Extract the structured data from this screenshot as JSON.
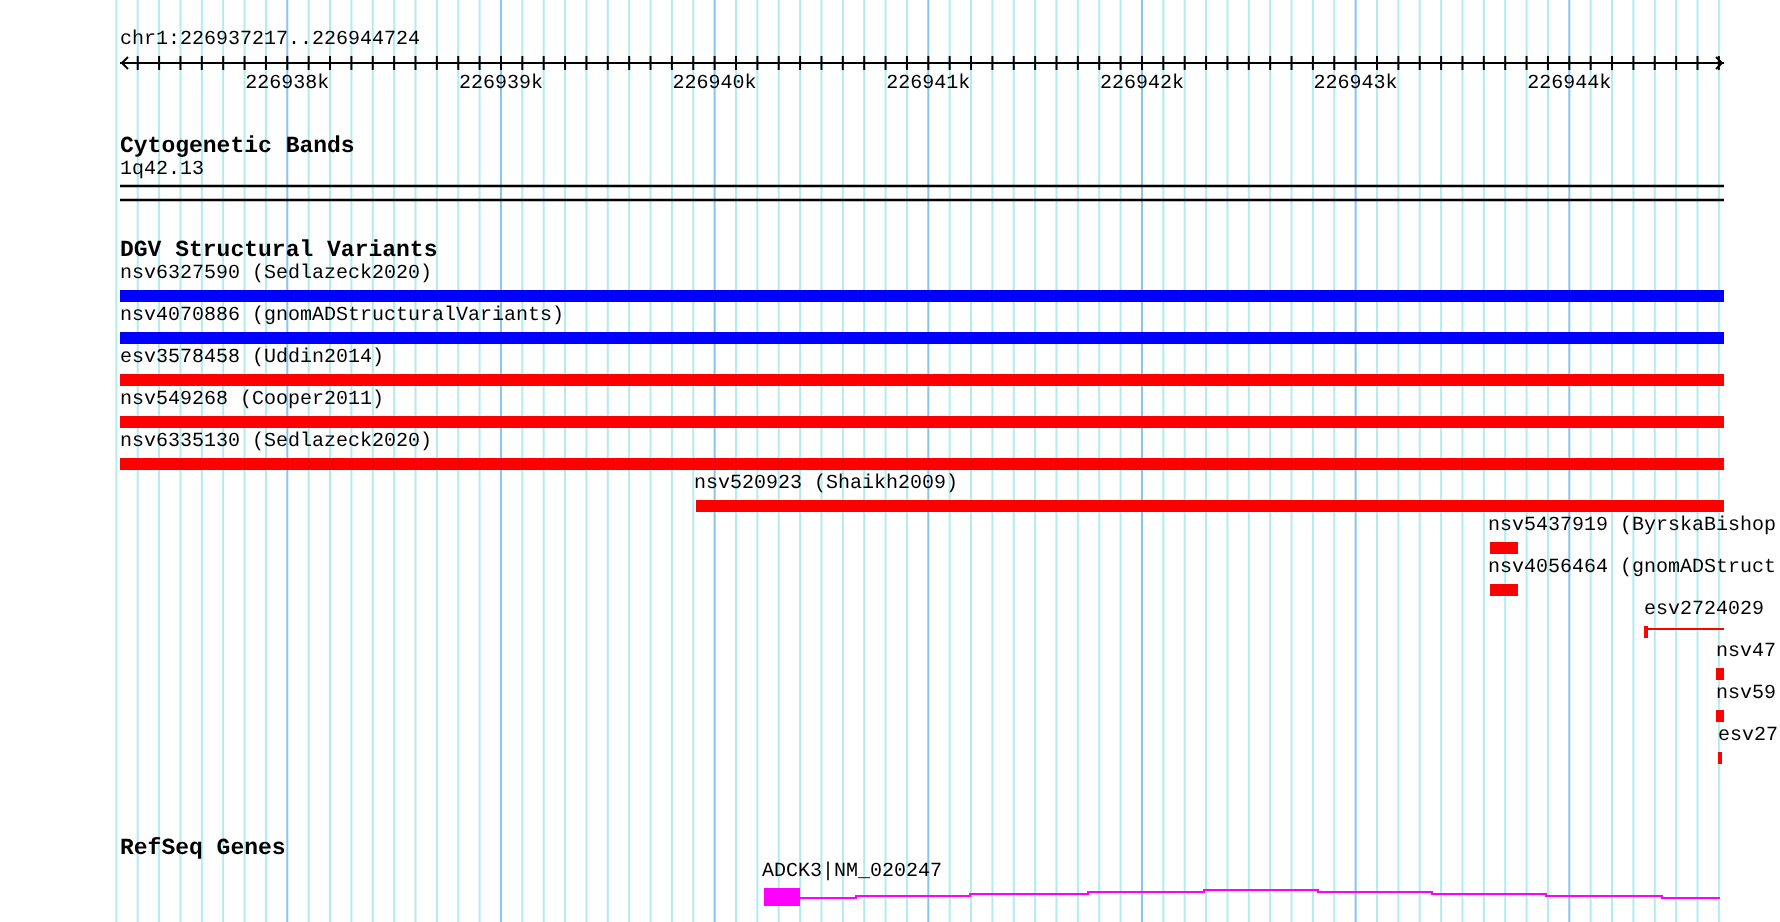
{
  "ruler": {
    "location": "chr1:226937217..226944724",
    "tick_labels": [
      "226938k",
      "226939k",
      "226940k",
      "226941k",
      "226942k",
      "226943k",
      "226944k"
    ]
  },
  "cytoband_track": {
    "title": "Cytogenetic Bands",
    "band_label": "1q42.13"
  },
  "dgv_track": {
    "title": "DGV Structural Variants",
    "features": [
      {
        "label": "nsv6327590 (Sedlazeck2020)",
        "color": "#0000ff",
        "kind": "bar"
      },
      {
        "label": "nsv4070886 (gnomADStructuralVariants)",
        "color": "#0000ff",
        "kind": "bar"
      },
      {
        "label": "esv3578458 (Uddin2014)",
        "color": "#ff0000",
        "kind": "bar"
      },
      {
        "label": "nsv549268 (Cooper2011)",
        "color": "#ff0000",
        "kind": "bar"
      },
      {
        "label": "nsv6335130 (Sedlazeck2020)",
        "color": "#ff0000",
        "kind": "bar"
      },
      {
        "label": "nsv520923 (Shaikh2009)",
        "color": "#ff0000",
        "kind": "bar"
      },
      {
        "label": "nsv5437919 (ByrskaBishop",
        "color": "#ff0000",
        "kind": "bar"
      },
      {
        "label": "nsv4056464 (gnomADStruct",
        "color": "#ff0000",
        "kind": "bar"
      },
      {
        "label": "esv2724029",
        "color": "#ff0000",
        "kind": "gapped"
      },
      {
        "label": "nsv47",
        "color": "#ff0000",
        "kind": "bar"
      },
      {
        "label": "nsv59",
        "color": "#ff0000",
        "kind": "bar"
      },
      {
        "label": "esv27",
        "color": "#ff0000",
        "kind": "bar"
      }
    ]
  },
  "refseq_track": {
    "title": "RefSeq Genes",
    "genes": [
      {
        "label": "ADCK3|NM_020247"
      }
    ]
  }
}
